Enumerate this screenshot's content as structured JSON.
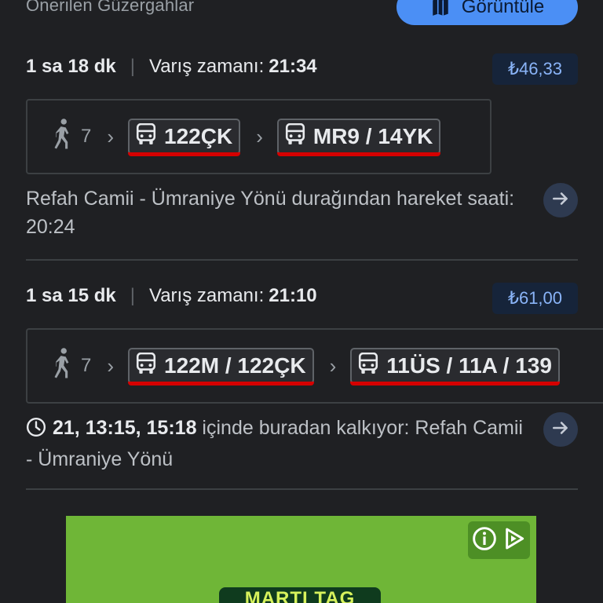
{
  "header": {
    "title": "Önerilen Güzergahlar",
    "view_button_label": "Görüntüle",
    "view_button_icon": "map-icon"
  },
  "routes": [
    {
      "duration": "1 sa 18 dk",
      "arrival_label": "Varış zamanı:",
      "arrival_time": "21:34",
      "fare": "₺46,33",
      "walk_minutes": "7",
      "legs": [
        "122ÇK",
        "MR9 / 14YK"
      ],
      "departure_text": "Refah Camii - Ümraniye Yönü durağından hareket saati: 20:24"
    },
    {
      "duration": "1 sa 15 dk",
      "arrival_label": "Varış zamanı:",
      "arrival_time": "21:10",
      "fare": "₺61,00",
      "walk_minutes": "7",
      "legs": [
        "122M / 122ÇK",
        "11ÜS / 11A / 139"
      ],
      "departure_times": "21, 13:15, 15:18",
      "departure_rest": " içinde buradan kalkıyor: Refah Camii - Ümraniye Yönü"
    }
  ],
  "ad": {
    "brand_text": "MARTI TAG",
    "background_color": "#6fb637",
    "icons": [
      "info-icon",
      "adchoices-icon"
    ]
  },
  "colors": {
    "accent": "#4b8ff5",
    "fare_text": "#8ab4f8",
    "line_underline": "#d50000"
  }
}
